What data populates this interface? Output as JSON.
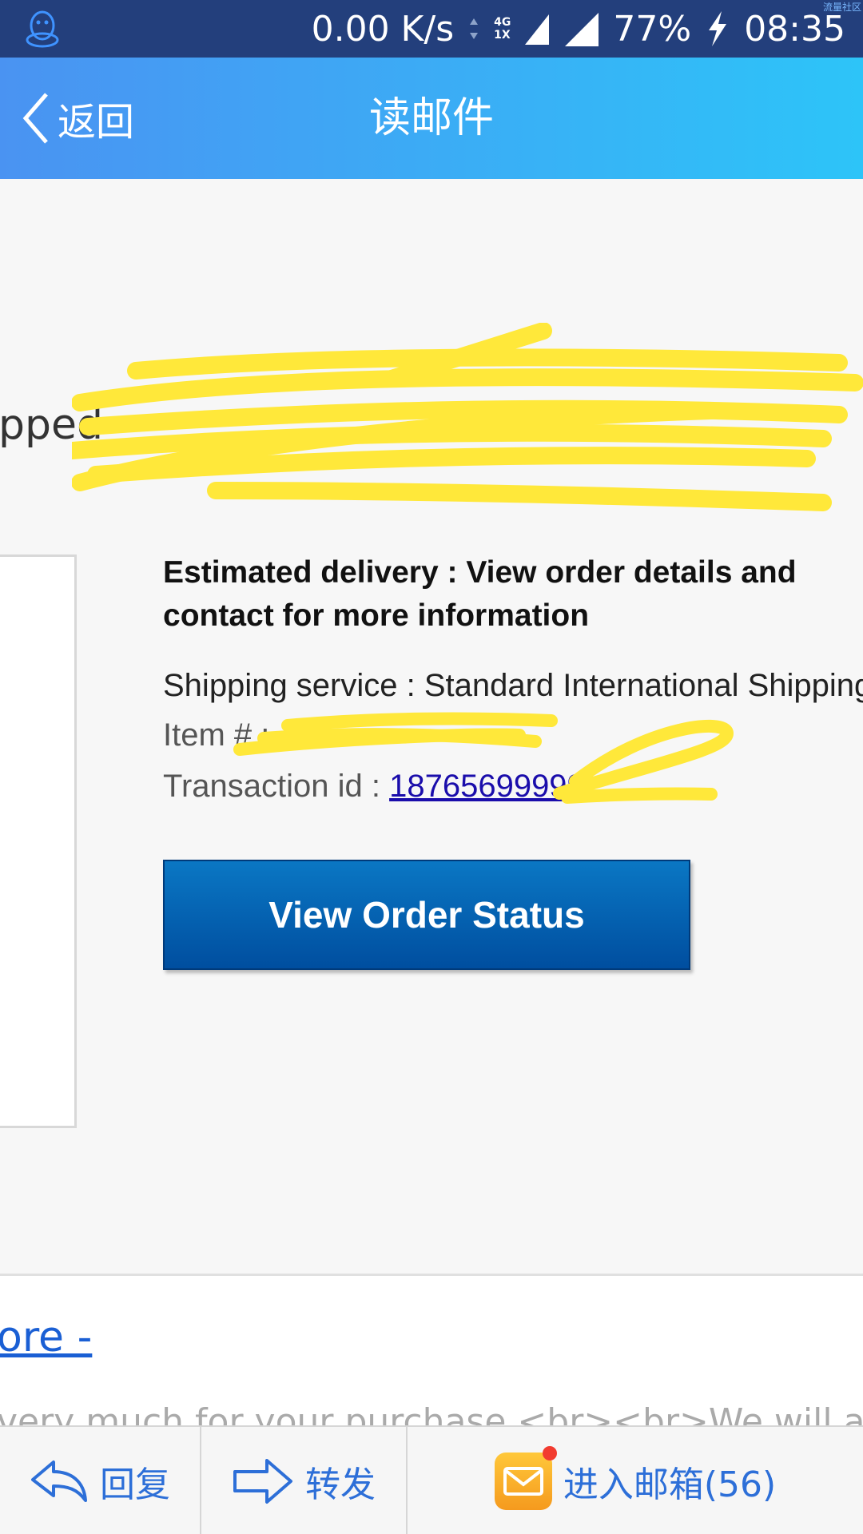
{
  "status_bar": {
    "net_speed": "0.00 K/s",
    "network_top": "4G",
    "network_bottom": "1X",
    "battery": "77%",
    "time": "08:35",
    "watermark": "流量社区"
  },
  "header": {
    "back_label": "返回",
    "title": "读邮件"
  },
  "email": {
    "shipped_heading": "pped",
    "estimated_delivery": "Estimated delivery : View order details and contact for more information",
    "shipping_service": "Shipping service : Standard International Shipping",
    "item_label": "Item # : ",
    "transaction_label": "Transaction id : ",
    "transaction_id": "18765699999",
    "view_order_button": "View Order Status",
    "more_link": "ore -",
    "thanks_text": "very much for your purchase <br><br>We will arrange"
  },
  "toolbar": {
    "reply_label": "回复",
    "forward_label": "转发",
    "inbox_label": "进入邮箱(56)"
  }
}
